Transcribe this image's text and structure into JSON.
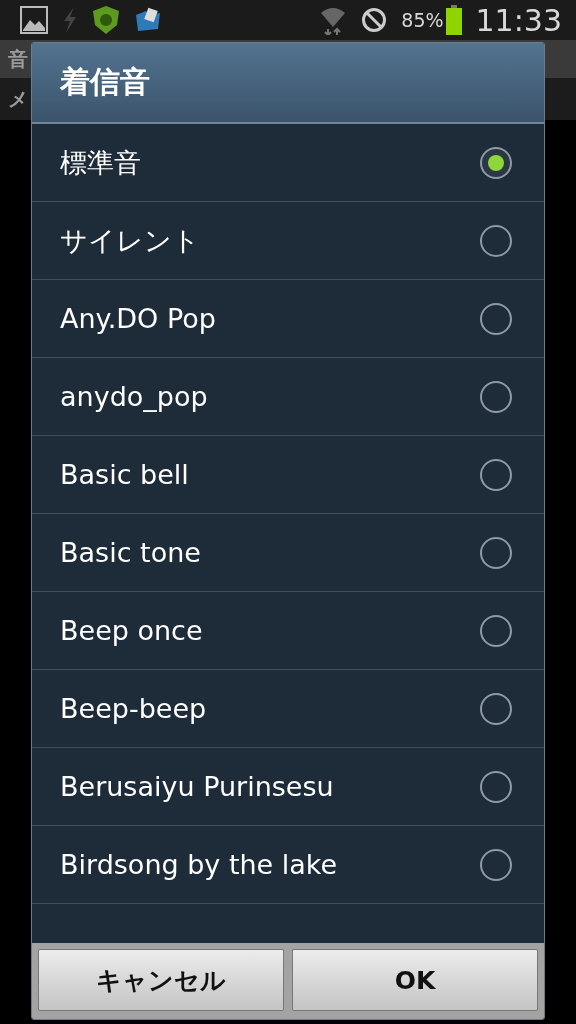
{
  "status_bar": {
    "battery": "85%",
    "time": "11:33"
  },
  "background": {
    "title": "音",
    "tab": "メ"
  },
  "dialog": {
    "title": "着信音",
    "options": [
      {
        "label": "標準音",
        "selected": true
      },
      {
        "label": "サイレント",
        "selected": false
      },
      {
        "label": "Any.DO Pop",
        "selected": false
      },
      {
        "label": "anydo_pop",
        "selected": false
      },
      {
        "label": "Basic bell",
        "selected": false
      },
      {
        "label": "Basic tone",
        "selected": false
      },
      {
        "label": "Beep once",
        "selected": false
      },
      {
        "label": "Beep-beep",
        "selected": false
      },
      {
        "label": "Berusaiyu Purinsesu",
        "selected": false
      },
      {
        "label": "Birdsong by the lake",
        "selected": false
      }
    ],
    "buttons": [
      "キャンセル",
      "OK"
    ]
  }
}
